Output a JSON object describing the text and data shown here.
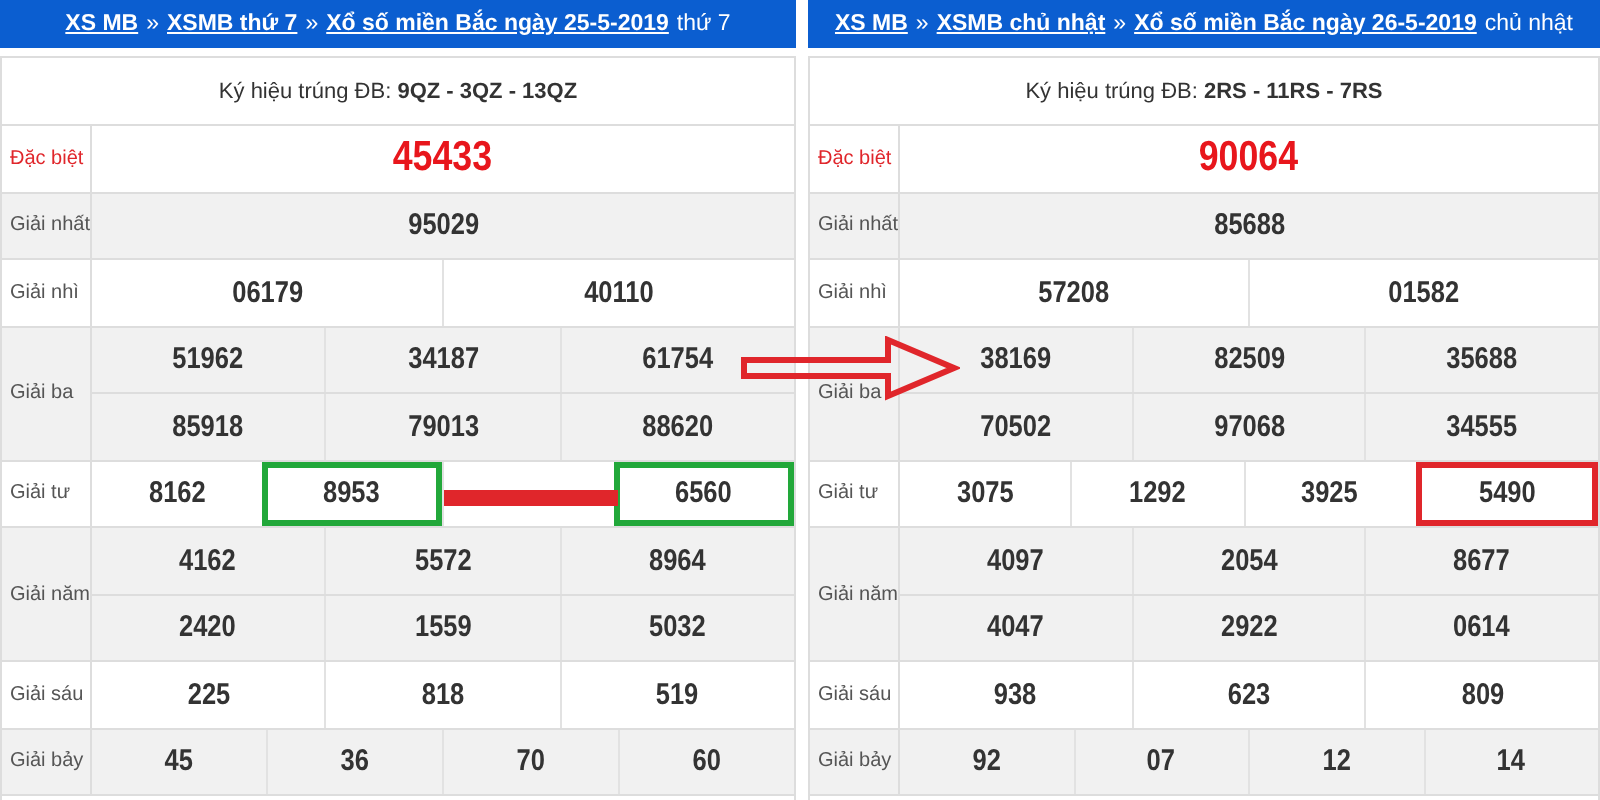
{
  "panels": [
    {
      "color": "#22a83a",
      "breadcrumb": [
        {
          "kind": "link",
          "text": "XS MB"
        },
        {
          "kind": "sep",
          "text": "»"
        },
        {
          "kind": "link",
          "text": "XSMB thứ 7"
        },
        {
          "kind": "sep",
          "text": "»"
        },
        {
          "kind": "link",
          "text": "Xổ số miền Bắc ngày 25-5-2019"
        },
        {
          "kind": "plain",
          "text": "thứ 7"
        }
      ],
      "symbol": "Ký hiệu trúng ĐB: **9QZ - 3QZ - 13QZ**",
      "prizes": [
        {
          "label": "Đặc biệt",
          "kind": "special",
          "rows": [
            [
              {
                "value": "45433",
                "highlighted": false
              }
            ]
          ]
        },
        {
          "label": "Giải nhất",
          "kind": "normal",
          "rows": [
            [
              {
                "value": "95029",
                "highlighted": false
              }
            ]
          ]
        },
        {
          "label": "Giải nhì",
          "kind": "normal",
          "rows": [
            [
              {
                "value": "06179",
                "highlighted": false
              },
              {
                "value": "40110",
                "highlighted": false
              }
            ]
          ]
        },
        {
          "label": "Giải ba",
          "kind": "normal",
          "rows": [
            [
              {
                "value": "51962",
                "highlighted": false
              },
              {
                "value": "34187",
                "highlighted": false
              },
              {
                "value": "61754",
                "highlighted": false
              }
            ],
            [
              {
                "value": "85918",
                "highlighted": false
              },
              {
                "value": "79013",
                "highlighted": false
              },
              {
                "value": "88620",
                "highlighted": false
              }
            ]
          ]
        },
        {
          "label": "Giải tư",
          "kind": "normal",
          "connector": true,
          "rows": [
            [
              {
                "value": "8162",
                "highlighted": false
              },
              {
                "value": "8953",
                "highlighted": true
              },
              {
                "highlighted": false
              },
              {
                "value": "6560",
                "highlighted": true
              }
            ]
          ]
        },
        {
          "label": "Giải năm",
          "kind": "normal",
          "rows": [
            [
              {
                "value": "4162",
                "highlighted": false
              },
              {
                "value": "5572",
                "highlighted": false
              },
              {
                "value": "8964",
                "highlighted": false
              }
            ],
            [
              {
                "value": "2420",
                "highlighted": false
              },
              {
                "value": "1559",
                "highlighted": false
              },
              {
                "value": "5032",
                "highlighted": false
              }
            ]
          ]
        },
        {
          "label": "Giải sáu",
          "kind": "normal",
          "rows": [
            [
              {
                "value": "225",
                "highlighted": false
              },
              {
                "value": "818",
                "highlighted": false
              },
              {
                "value": "519",
                "highlighted": false
              }
            ]
          ]
        },
        {
          "label": "Giải bảy",
          "kind": "normal",
          "rows": [
            [
              {
                "value": "45",
                "highlighted": false
              },
              {
                "value": "36",
                "highlighted": false
              },
              {
                "value": "70",
                "highlighted": false
              },
              {
                "value": "60",
                "highlighted": false
              }
            ]
          ]
        }
      ]
    },
    {
      "color": "#e0262b",
      "breadcrumb": [
        {
          "kind": "link",
          "text": "XS MB"
        },
        {
          "kind": "sep",
          "text": "»"
        },
        {
          "kind": "link",
          "text": "XSMB chủ nhật"
        },
        {
          "kind": "sep",
          "text": "»"
        },
        {
          "kind": "link",
          "text": "Xổ số miền Bắc ngày 26-5-2019"
        },
        {
          "kind": "plain",
          "text": "chủ nhật"
        }
      ],
      "symbol": "Ký hiệu trúng ĐB: **2RS - 11RS - 7RS**",
      "prizes": [
        {
          "label": "Đặc biệt",
          "kind": "special",
          "rows": [
            [
              {
                "value": "90064",
                "highlighted": false
              }
            ]
          ]
        },
        {
          "label": "Giải nhất",
          "kind": "normal",
          "rows": [
            [
              {
                "value": "85688",
                "highlighted": false
              }
            ]
          ]
        },
        {
          "label": "Giải nhì",
          "kind": "normal",
          "rows": [
            [
              {
                "value": "57208",
                "highlighted": false
              },
              {
                "value": "01582",
                "highlighted": false
              }
            ]
          ]
        },
        {
          "label": "Giải ba",
          "kind": "normal",
          "rows": [
            [
              {
                "value": "38169",
                "highlighted": false
              },
              {
                "value": "82509",
                "highlighted": false
              },
              {
                "value": "35688",
                "highlighted": false
              }
            ],
            [
              {
                "value": "70502",
                "highlighted": false
              },
              {
                "value": "97068",
                "highlighted": false
              },
              {
                "value": "34555",
                "highlighted": false
              }
            ]
          ]
        },
        {
          "label": "Giải tư",
          "kind": "normal",
          "connector": false,
          "rows": [
            [
              {
                "value": "3075",
                "highlighted": false
              },
              {
                "value": "1292",
                "highlighted": false
              },
              {
                "value": "3925",
                "highlighted": false
              },
              {
                "value": "5490",
                "highlighted": true
              }
            ]
          ]
        },
        {
          "label": "Giải năm",
          "kind": "normal",
          "rows": [
            [
              {
                "value": "4097",
                "highlighted": false
              },
              {
                "value": "2054",
                "highlighted": false
              },
              {
                "value": "8677",
                "highlighted": false
              }
            ],
            [
              {
                "value": "4047",
                "highlighted": false
              },
              {
                "value": "2922",
                "highlighted": false
              },
              {
                "value": "0614",
                "highlighted": false
              }
            ]
          ]
        },
        {
          "label": "Giải sáu",
          "kind": "normal",
          "rows": [
            [
              {
                "value": "938",
                "highlighted": false
              },
              {
                "value": "623",
                "highlighted": false
              },
              {
                "value": "809",
                "highlighted": false
              }
            ]
          ]
        },
        {
          "label": "Giải bảy",
          "kind": "normal",
          "rows": [
            [
              {
                "value": "92",
                "highlighted": false
              },
              {
                "value": "07",
                "highlighted": false
              },
              {
                "value": "12",
                "highlighted": false
              },
              {
                "value": "14",
                "highlighted": false
              }
            ]
          ]
        }
      ]
    }
  ]
}
